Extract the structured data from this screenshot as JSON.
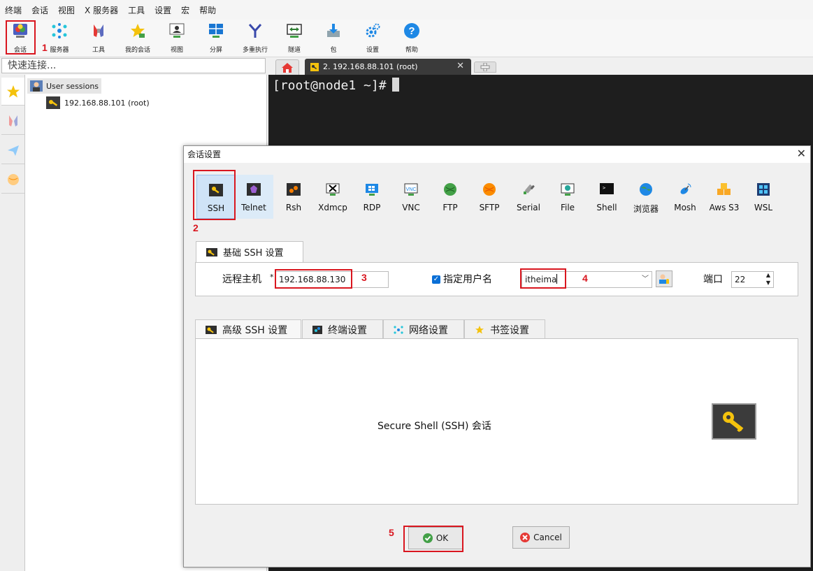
{
  "menu": [
    "终端",
    "会话",
    "视图",
    "X 服务器",
    "工具",
    "设置",
    "宏",
    "帮助"
  ],
  "toolbar": [
    {
      "label": "会话",
      "icon": "session-icon"
    },
    {
      "label": "服务器",
      "icon": "servers-icon"
    },
    {
      "label": "工具",
      "icon": "tools-icon"
    },
    {
      "label": "我的会话",
      "icon": "star-icon"
    },
    {
      "label": "视图",
      "icon": "view-icon"
    },
    {
      "label": "分屏",
      "icon": "split-icon"
    },
    {
      "label": "多重执行",
      "icon": "fork-icon"
    },
    {
      "label": "隧道",
      "icon": "tunnel-icon"
    },
    {
      "label": "包",
      "icon": "package-icon"
    },
    {
      "label": "设置",
      "icon": "gear-icon"
    },
    {
      "label": "帮助",
      "icon": "help-icon"
    }
  ],
  "quick_connect": {
    "placeholder": "快速连接..."
  },
  "tree": {
    "root": "User sessions",
    "items": [
      "192.168.88.101 (root)"
    ]
  },
  "tabs": {
    "active": "2. 192.168.88.101 (root)"
  },
  "terminal": {
    "prompt": "[root@node1 ~]#"
  },
  "dialog": {
    "title": "会话设置",
    "protocols": [
      "SSH",
      "Telnet",
      "Rsh",
      "Xdmcp",
      "RDP",
      "VNC",
      "FTP",
      "SFTP",
      "Serial",
      "File",
      "Shell",
      "浏览器",
      "Mosh",
      "Aws S3",
      "WSL"
    ],
    "basic_tab": "基础 SSH 设置",
    "remote_host_label": "远程主机",
    "required_mark": "*",
    "remote_host_value": "192.168.88.130",
    "specify_user_label": "指定用户名",
    "username_value": "itheima",
    "port_label": "端口",
    "port_value": "22",
    "adv_tabs": [
      "高级 SSH 设置",
      "终端设置",
      "网络设置",
      "书签设置"
    ],
    "description": "Secure Shell (SSH) 会话",
    "ok": "OK",
    "cancel": "Cancel"
  },
  "annotations": [
    "1",
    "2",
    "3",
    "4",
    "5"
  ],
  "colors": {
    "annotation": "#d9161f",
    "terminal_bg": "#1e1e1e",
    "selected_protocol": "#cfe3f7",
    "checkbox": "#0a6fd6"
  }
}
